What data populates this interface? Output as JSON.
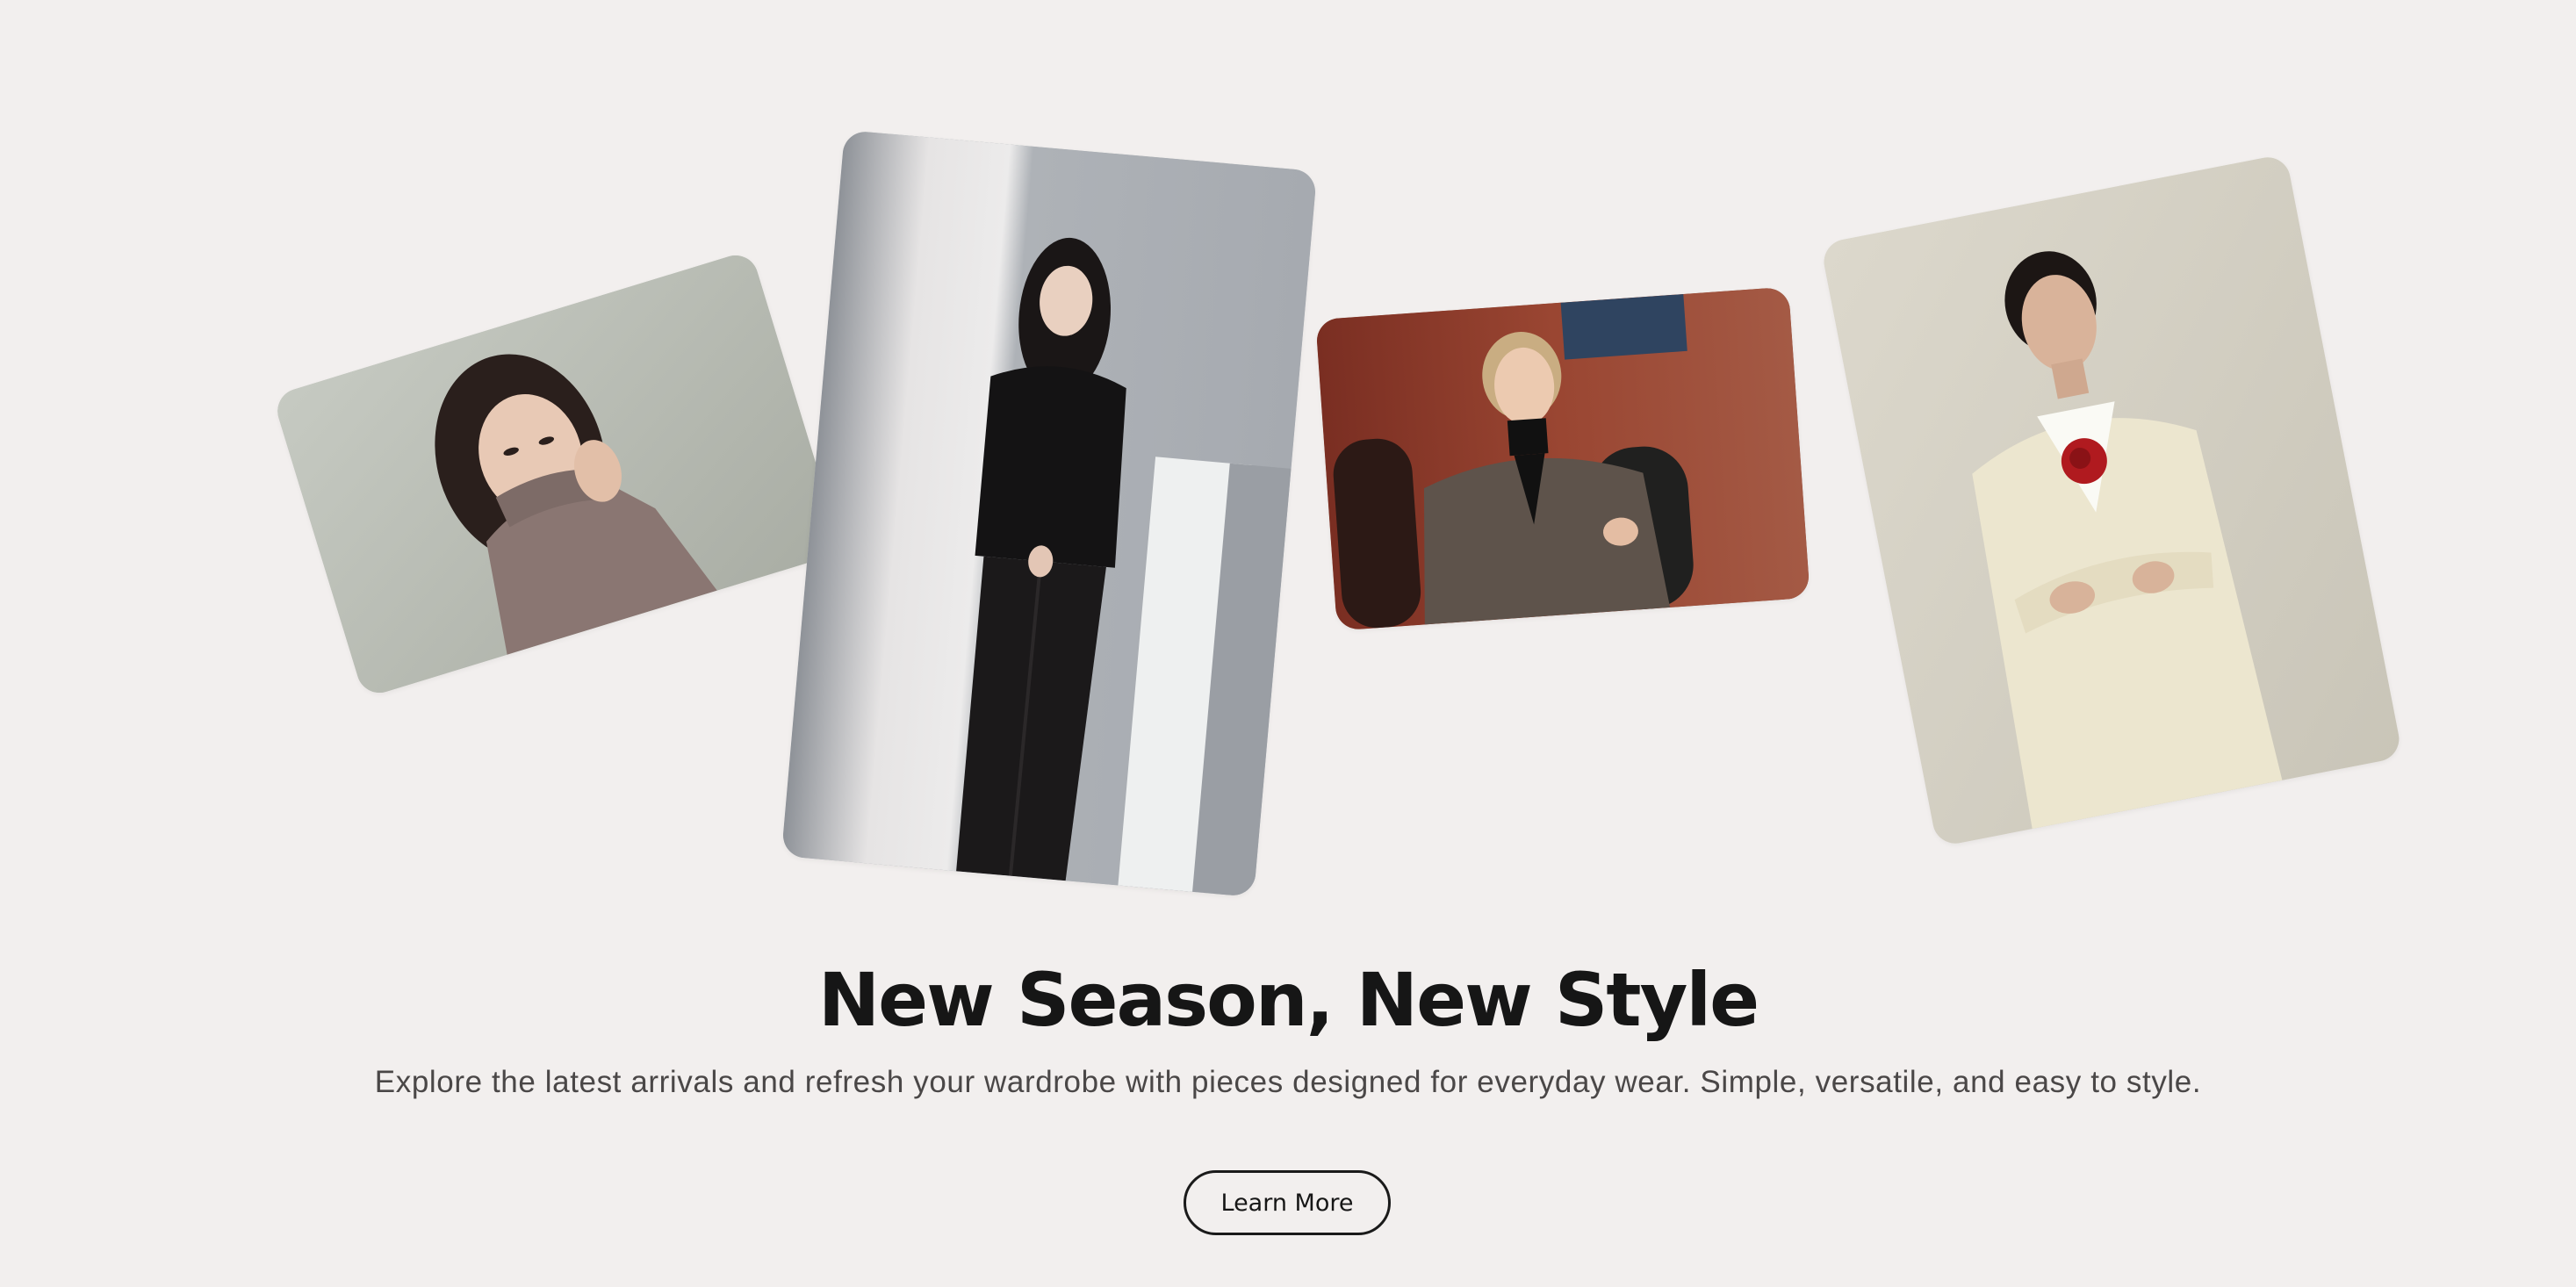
{
  "hero": {
    "headline": "New Season, New Style",
    "subheadline": "Explore the latest arrivals and refresh your wardrobe with pieces designed for everyday wear. Simple, versatile, and easy to style.",
    "cta_label": "Learn More"
  },
  "gallery": [
    {
      "subject": "woman in checked turtleneck covering face",
      "background": "#b8bcb3"
    },
    {
      "subject": "woman in black leather suit",
      "background": "#a8adb3"
    },
    {
      "subject": "woman in brown blazer before brick wall",
      "background": "#8c3f2c"
    },
    {
      "subject": "woman in cream suit with red rose",
      "background": "#d8d4c6"
    }
  ],
  "colors": {
    "page_background": "#f2efee",
    "headline": "#161616",
    "body_text": "#4a4747",
    "button_border": "#1a1a1a"
  }
}
